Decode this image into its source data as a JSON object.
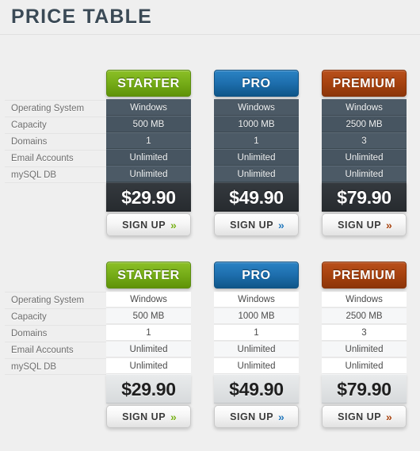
{
  "page": {
    "title": "PRICE TABLE",
    "background_color": "#efefef"
  },
  "feature_labels": [
    "Operating System",
    "Capacity",
    "Domains",
    "Email Accounts",
    "mySQL DB"
  ],
  "signup_label": "SIGN UP",
  "chevron_glyph": "»",
  "theme_colors": {
    "starter": "#76ad18",
    "pro": "#1e6fae",
    "premium": "#a7420f",
    "dark_cell": "#4c5a66",
    "dark_price": "#2b2f33",
    "light_cell": "#ffffff",
    "light_price": "#dfe2e4",
    "title_text": "#3b4a56"
  },
  "tables": [
    {
      "variant": "dark",
      "plans": [
        {
          "name": "STARTER",
          "accent": "green",
          "price": "$29.90",
          "features": [
            "Windows",
            "500 MB",
            "1",
            "Unlimited",
            "Unlimited"
          ]
        },
        {
          "name": "PRO",
          "accent": "blue",
          "price": "$49.90",
          "features": [
            "Windows",
            "1000 MB",
            "1",
            "Unlimited",
            "Unlimited"
          ]
        },
        {
          "name": "PREMIUM",
          "accent": "orange",
          "price": "$79.90",
          "features": [
            "Windows",
            "2500 MB",
            "3",
            "Unlimited",
            "Unlimited"
          ]
        }
      ]
    },
    {
      "variant": "light",
      "plans": [
        {
          "name": "STARTER",
          "accent": "green",
          "price": "$29.90",
          "features": [
            "Windows",
            "500 MB",
            "1",
            "Unlimited",
            "Unlimited"
          ]
        },
        {
          "name": "PRO",
          "accent": "blue",
          "price": "$49.90",
          "features": [
            "Windows",
            "1000 MB",
            "1",
            "Unlimited",
            "Unlimited"
          ]
        },
        {
          "name": "PREMIUM",
          "accent": "orange",
          "price": "$79.90",
          "features": [
            "Windows",
            "2500 MB",
            "3",
            "Unlimited",
            "Unlimited"
          ]
        }
      ]
    }
  ]
}
